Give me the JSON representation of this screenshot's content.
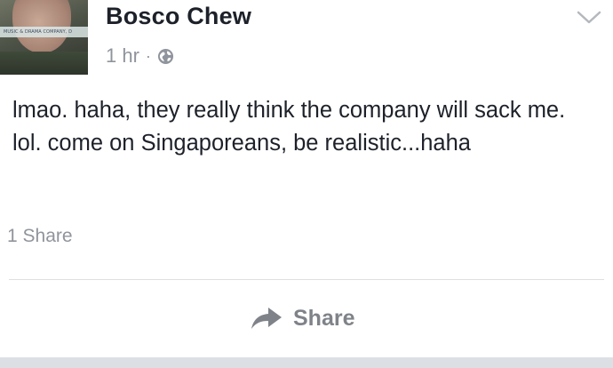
{
  "post": {
    "author": "Bosco Chew",
    "avatar_caption": "MUSIC & DRAMA COMPANY, D",
    "timestamp": "1 hr",
    "separator": "·",
    "privacy_icon": "globe-icon",
    "menu_icon": "chevron-down-icon",
    "text": "lmao. haha, they really think the company will sack me. lol. come on Singaporeans, be realistic...haha",
    "share_count": "1 Share",
    "share_button_label": "Share",
    "share_icon": "share-arrow-icon"
  },
  "colors": {
    "name_text": "#1d2129",
    "meta_text": "#90949c",
    "share_label": "#7f8389",
    "divider": "#dddfe2"
  }
}
